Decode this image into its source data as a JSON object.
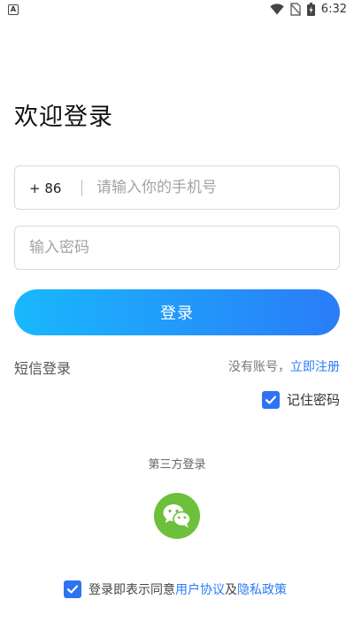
{
  "status_bar": {
    "app_icon_letter": "A",
    "time": "6:32"
  },
  "page": {
    "title": "欢迎登录"
  },
  "phone_field": {
    "country_code": "+ 86",
    "placeholder": "请输入你的手机号",
    "value": ""
  },
  "password_field": {
    "placeholder": "输入密码",
    "value": ""
  },
  "login_button": {
    "label": "登录"
  },
  "links": {
    "sms_login": "短信登录",
    "no_account": "没有账号，",
    "register": "立即注册"
  },
  "remember": {
    "label": "记住密码",
    "checked": true
  },
  "third_party": {
    "label": "第三方登录",
    "icon": "wechat-icon"
  },
  "agreement": {
    "checked": true,
    "prefix": "登录即表示同意",
    "user_agreement": "用户协议",
    "and": "及",
    "privacy_policy": "隐私政策"
  },
  "colors": {
    "primary": "#2a7cf8",
    "gradient_start": "#19b8fd",
    "wechat_green": "#6cc03b"
  }
}
